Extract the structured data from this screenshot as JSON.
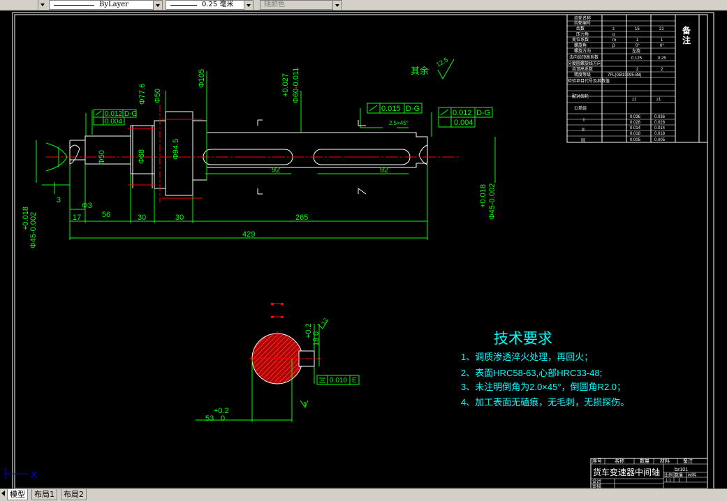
{
  "toolbar": {
    "linetype": "ByLayer",
    "lineweight": "0.25 毫米",
    "plotstyle": "随颜色"
  },
  "drawing": {
    "surface_note": "其余",
    "surface_value": "12.5",
    "tol_frame_1": {
      "tol": "0.012",
      "datum": "D-G"
    },
    "tol_frame_1b": "0.004",
    "tol_frame_2": {
      "tol": "0.015",
      "datum": "D-G"
    },
    "tol_frame_3": {
      "tol": "0.012",
      "datum": "D-G"
    },
    "tol_frame_3b": "0.004",
    "tol_frame_4": {
      "tol": "0.010",
      "datum": "E"
    },
    "chamfer": "2.5×45°",
    "dims": {
      "d105": "Φ105",
      "d77": "Φ77.6",
      "d50a": "Φ50",
      "d60tol_top": "+0.027",
      "d60tol_bot": "Φ60-0.011",
      "d94": "Φ94.5",
      "d68": "Φ68",
      "d50b": "Φ50",
      "k92a": "92",
      "k92b": "92",
      "d45l_top": "+0.018",
      "d45l_bot": "Φ45-0.002",
      "d45r_top": "+0.018",
      "d45r_bot": "Φ45-0.002",
      "l3a": "3",
      "l3b": "Φ3",
      "l17": "17",
      "l56": "56",
      "l30a": "30",
      "l30b": "30",
      "l265": "265",
      "l429": "429",
      "sec_h_top": "+0.2",
      "sec_h": "18",
      "sec_h_bot": "0",
      "sec_d_top": "+0.2",
      "sec_d": "53",
      "sec_d_bot": "0",
      "rough32": "3.2",
      "rough3": "3"
    }
  },
  "tech": {
    "title": "技术要求",
    "items": [
      "1、调质渗透淬火处理，再回火；",
      "2、表面HRC58-63,心部HRC33-48;",
      "3、未注明倒角为2.0×45°，倒圆角R2.0；",
      "4、加工表面无磕痕，无毛刺，无损探伤。"
    ]
  },
  "param_table": {
    "remark": "备注",
    "labels": [
      "齿轮名称",
      "齿轮编号",
      "齿数",
      "压力角",
      "变位系数",
      "螺旋角",
      "螺旋方向",
      "法向齿顶高系数",
      "分度圆螺旋线方向",
      "齿顶高系数",
      "精度等级",
      "检验项目代号及其数值",
      "配对齿轮",
      "公差组"
    ],
    "values": [
      "z",
      "α",
      "m",
      "β",
      "左旋",
      "0.125",
      "0.25",
      "7FL(GB10095-88)",
      "z1",
      "z1"
    ],
    "group_rows": [
      "I",
      "II",
      "III"
    ],
    "small_vals": [
      "0.036",
      "0.036",
      "0.028",
      "0.028",
      "0.014",
      "0.014",
      "0.018",
      "0.018",
      "0.005",
      "0.005"
    ],
    "nums": [
      "15",
      "21",
      "1",
      "1",
      "0°",
      "0°",
      "2",
      "2"
    ]
  },
  "title_block": {
    "headers": [
      "序号",
      "名称",
      "数量",
      "材料",
      "备注"
    ],
    "name": "货车变速器中间轴",
    "code": "bz101",
    "scale_labels": [
      "比例",
      "数量",
      "材料"
    ],
    "scale_values": [
      "1:1",
      "1"
    ],
    "roles": [
      "设计",
      "审核"
    ]
  },
  "ucs": {
    "x": "X"
  },
  "tabs": [
    "模型",
    "布局1",
    "布局2"
  ],
  "colors": {
    "background": "#000000",
    "white": "#ffffff",
    "green": "#00ff00",
    "red": "#ff0000",
    "cyan": "#00ffff",
    "blue": "#0000ff",
    "hatch": "#b40000",
    "ui": "#d4d0c8"
  }
}
